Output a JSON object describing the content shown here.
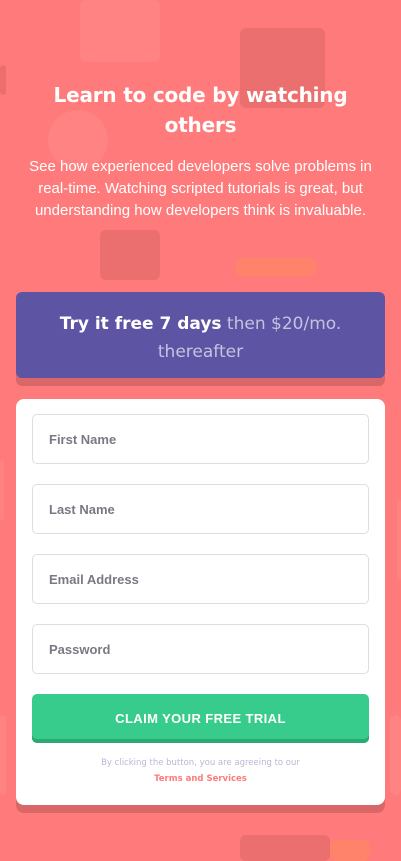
{
  "colors": {
    "background": "#ff7a7a",
    "offer_bg": "#5e54a4",
    "cta_green": "#38cc8c",
    "terms_link": "#ff7a7a"
  },
  "hero": {
    "title": "Learn to code by watching others",
    "description": "See how experienced developers solve problems in real-time. Watching scripted tutorials is great, but understanding how developers think is invaluable."
  },
  "offer": {
    "highlight": "Try it free 7 days",
    "rest": " then $20/mo. thereafter"
  },
  "form": {
    "first_name_placeholder": "First Name",
    "last_name_placeholder": "Last Name",
    "email_placeholder": "Email Address",
    "password_placeholder": "Password",
    "submit_label": "Claim your free trial",
    "terms_prefix": "By clicking the button, you are agreeing to our",
    "terms_link": "Terms and Services"
  }
}
